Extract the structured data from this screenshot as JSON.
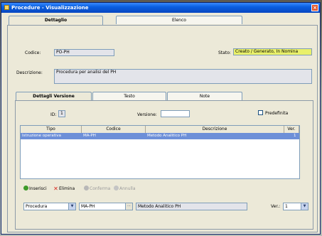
{
  "window": {
    "title": "Procedure - Visualizzazione",
    "close": "×"
  },
  "main_tabs": [
    {
      "label": "Dettaglio"
    },
    {
      "label": "Elenco"
    }
  ],
  "detail": {
    "codice_label": "Codice:",
    "codice_value": "PO-PH",
    "stato_label": "Stato:",
    "stato_value": "Creato / Generato, In Nomina",
    "descrizione_label": "Descrizione:",
    "descrizione_value": "Procedura per analisi del PH"
  },
  "sub_tabs": [
    {
      "label": "Dettagli Versione"
    },
    {
      "label": "Testo"
    },
    {
      "label": "Note"
    }
  ],
  "version": {
    "id_label": "ID:",
    "id_value": "1",
    "versione_label": "Versione:",
    "versione_value": "",
    "predefinita_label": "Predefinita"
  },
  "grid": {
    "columns": [
      "Tipo",
      "Codice",
      "Descrizione",
      "Ver."
    ],
    "rows": [
      {
        "tipo": "Istruzione operativa",
        "codice": "MA-PH",
        "descrizione": "Metodo Analitico PH",
        "ver": "1"
      }
    ]
  },
  "actions": {
    "inserisci": "Inserisci",
    "elimina": "Elimina",
    "conferma": "Conferma",
    "annulla": "Annulla"
  },
  "editor": {
    "tipo_value": "Procedura",
    "codice_value": "MA-PH",
    "descrizione_value": "Metodo Analitico PH",
    "ver_label": "Ver.:",
    "ver_value": "1"
  },
  "colors": {
    "title_bar": "#0a5fe0",
    "stato_highlight": "#e9f06a",
    "selected_row": "#6d8fd8",
    "elimina_icon": "#d8241a",
    "inserisci_icon": "#3d9a2a"
  },
  "icons": [
    "window-icon",
    "close-icon",
    "add-icon",
    "delete-icon",
    "confirm-icon",
    "cancel-icon",
    "dropdown-arrow-icon",
    "lookup-icon"
  ]
}
